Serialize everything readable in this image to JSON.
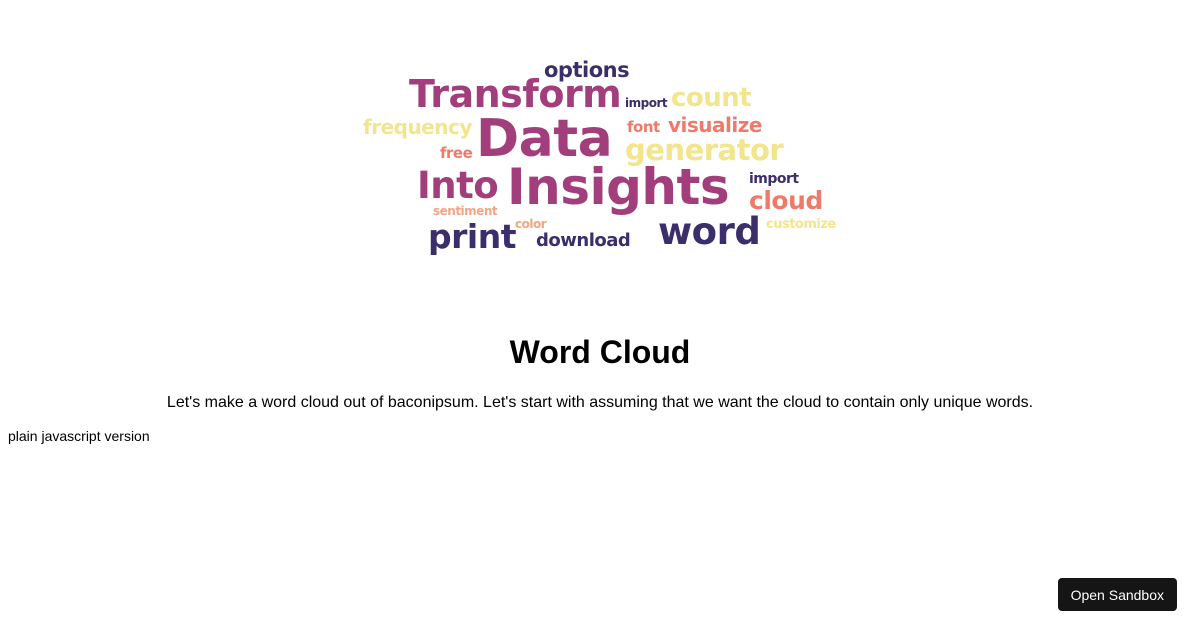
{
  "cloud": {
    "words": [
      {
        "text": "options",
        "color": "#3b2e6b"
      },
      {
        "text": "Transform",
        "color": "#a23e7b"
      },
      {
        "text": "import",
        "color": "#3b2e6b"
      },
      {
        "text": "count",
        "color": "#f2e58c"
      },
      {
        "text": "frequency",
        "color": "#f2e58c"
      },
      {
        "text": "Data",
        "color": "#a23e7b"
      },
      {
        "text": "font",
        "color": "#ef7a6a"
      },
      {
        "text": "visualize",
        "color": "#ef7a6a"
      },
      {
        "text": "free",
        "color": "#ef7a6a"
      },
      {
        "text": "generator",
        "color": "#f2e58c"
      },
      {
        "text": "Into",
        "color": "#a23e7b"
      },
      {
        "text": "Insights",
        "color": "#a23e7b"
      },
      {
        "text": "import",
        "color": "#3b2e6b"
      },
      {
        "text": "cloud",
        "color": "#ef7a6a"
      },
      {
        "text": "sentiment",
        "color": "#f4a582"
      },
      {
        "text": "color",
        "color": "#f4a582"
      },
      {
        "text": "customize",
        "color": "#f2e58c"
      },
      {
        "text": "print",
        "color": "#3b2e6b"
      },
      {
        "text": "download",
        "color": "#3b2e6b"
      },
      {
        "text": "word",
        "color": "#3b2e6b"
      }
    ]
  },
  "main": {
    "title": "Word Cloud",
    "intro": "Let's make a word cloud out of baconipsum. Let's start with assuming that we want the cloud to contain only unique words.",
    "plain_link": "plain javascript version"
  },
  "sandbox": {
    "button_label": "Open Sandbox"
  }
}
